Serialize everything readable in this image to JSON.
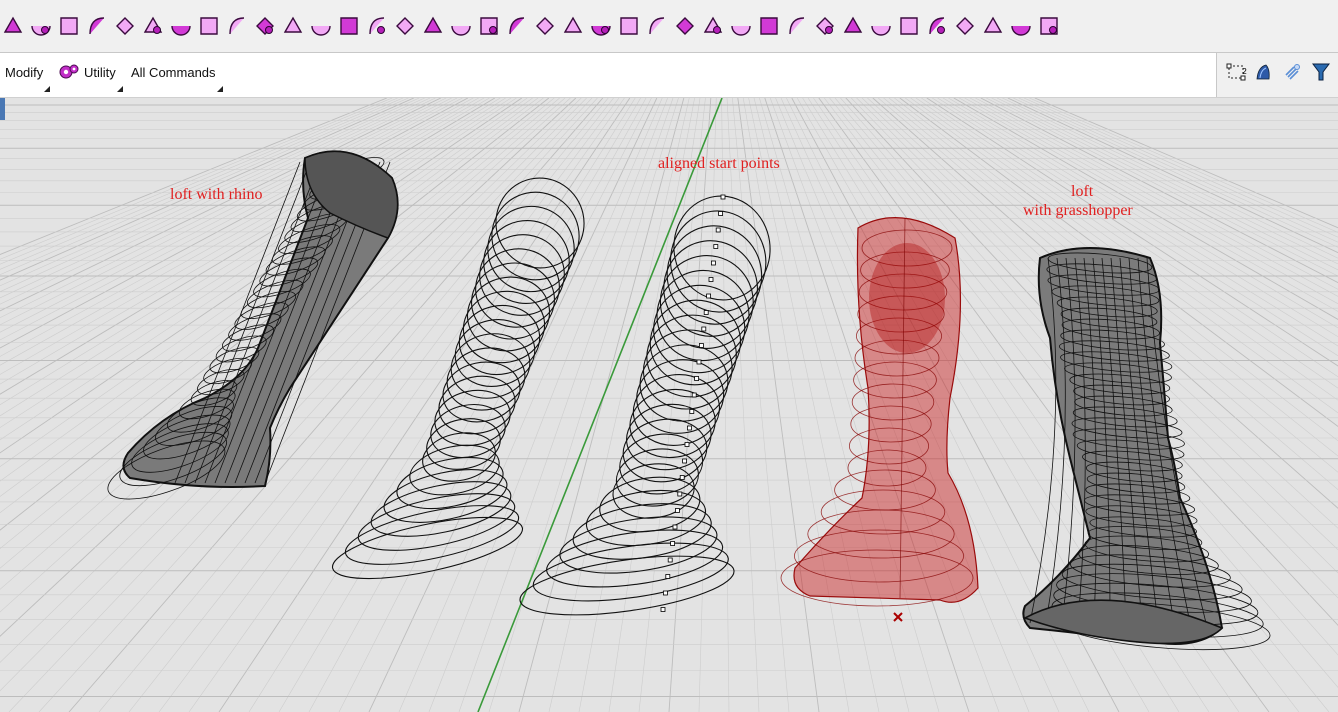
{
  "toolbar": {
    "icons": [
      "loft-icon",
      "rebuild-icon",
      "extend-icon",
      "fillet-icon",
      "arc-icon",
      "split-icon",
      "offset-icon",
      "box-icon",
      "grid-icon",
      "move-icon",
      "pink-solid-icon",
      "rotate-icon",
      "cage-icon",
      "checkbox-icon",
      "mesh-icon",
      "cube-icon",
      "cross-mesh-icon",
      "sweep-icon",
      "network-icon",
      "blend-icon",
      "flow-icon",
      "mirror-icon",
      "grid-points-icon",
      "curve-network-icon",
      "fold-icon",
      "scatter-icon",
      "twist-icon",
      "plane-icon",
      "target-icon",
      "star-icon",
      "pentagon-icon",
      "stretch-icon",
      "morph-icon",
      "rebuild-surface-icon",
      "patch-icon",
      "scissors-icon",
      "dark-box-icon",
      "gear-icon"
    ]
  },
  "menubar": {
    "tabs": [
      {
        "label": "Modify",
        "name": "tab-modify"
      },
      {
        "label": "Utility",
        "name": "tab-utility"
      },
      {
        "label": "All Commands",
        "name": "tab-all-commands"
      }
    ],
    "side_tools": [
      "selection-frame-icon",
      "history-icon",
      "light-icon",
      "funnel-icon"
    ]
  },
  "viewport": {
    "labels": {
      "loft_rhino": "loft with rhino",
      "aligned": "aligned start points",
      "loft_gh_line1": "loft",
      "loft_gh_line2": "with grasshopper"
    },
    "colors": {
      "grid_bg": "#e3e3e3",
      "grid_line": "#c6c6c6",
      "axis_green": "#3a9a3a",
      "label_red": "#e02020",
      "shaded_red": "#c81818"
    }
  }
}
